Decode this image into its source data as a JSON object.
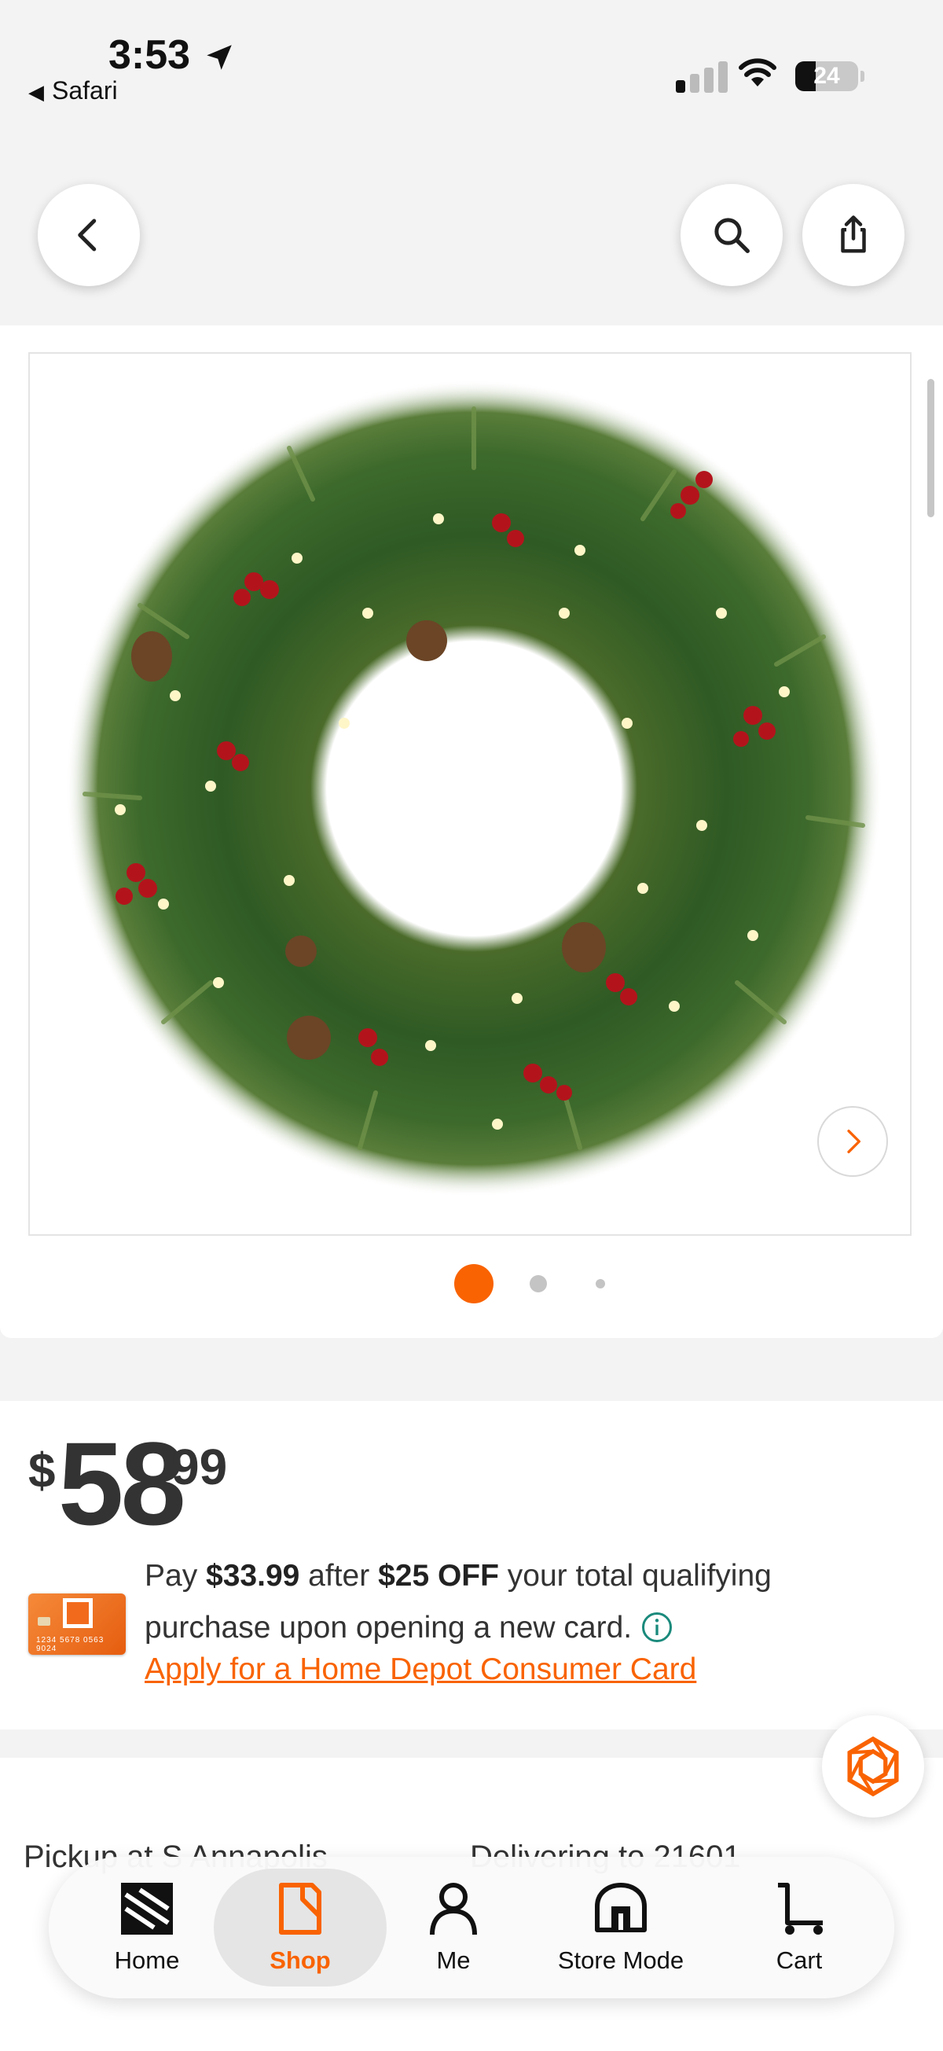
{
  "status_bar": {
    "time": "3:53",
    "back_app": "Safari",
    "battery": "24"
  },
  "header": {
    "back_icon": "chevron-left-icon",
    "search_icon": "search-icon",
    "share_icon": "share-icon"
  },
  "gallery": {
    "image_alt": "Lighted Christmas wreath with pine cones and red berries",
    "slide_count": 3,
    "active_slide": 1
  },
  "product": {
    "price": {
      "currency": "$",
      "dollars": "58",
      "cents": "99"
    },
    "promo": {
      "pre": "Pay ",
      "pay_amount": "$33.99",
      "mid": " after ",
      "discount": "$25 OFF",
      "post": " your total qualifying purchase upon opening a new card.",
      "card_number": "1234 5678 0563 9024",
      "link": "Apply for a Home Depot Consumer Card"
    }
  },
  "fulfillment": {
    "pickup": "Pickup at S Annapolis",
    "delivery": "Delivering to 21601"
  },
  "nav": {
    "items": [
      {
        "label": "Home",
        "icon": "home-depot-logo-icon"
      },
      {
        "label": "Shop",
        "icon": "shop-tag-icon",
        "active": true
      },
      {
        "label": "Me",
        "icon": "person-icon"
      },
      {
        "label": "Store Mode",
        "icon": "store-icon"
      },
      {
        "label": "Cart",
        "icon": "cart-icon"
      }
    ]
  },
  "colors": {
    "accent": "#f96302",
    "text": "#333333",
    "teal_info": "#1a8a7c"
  }
}
